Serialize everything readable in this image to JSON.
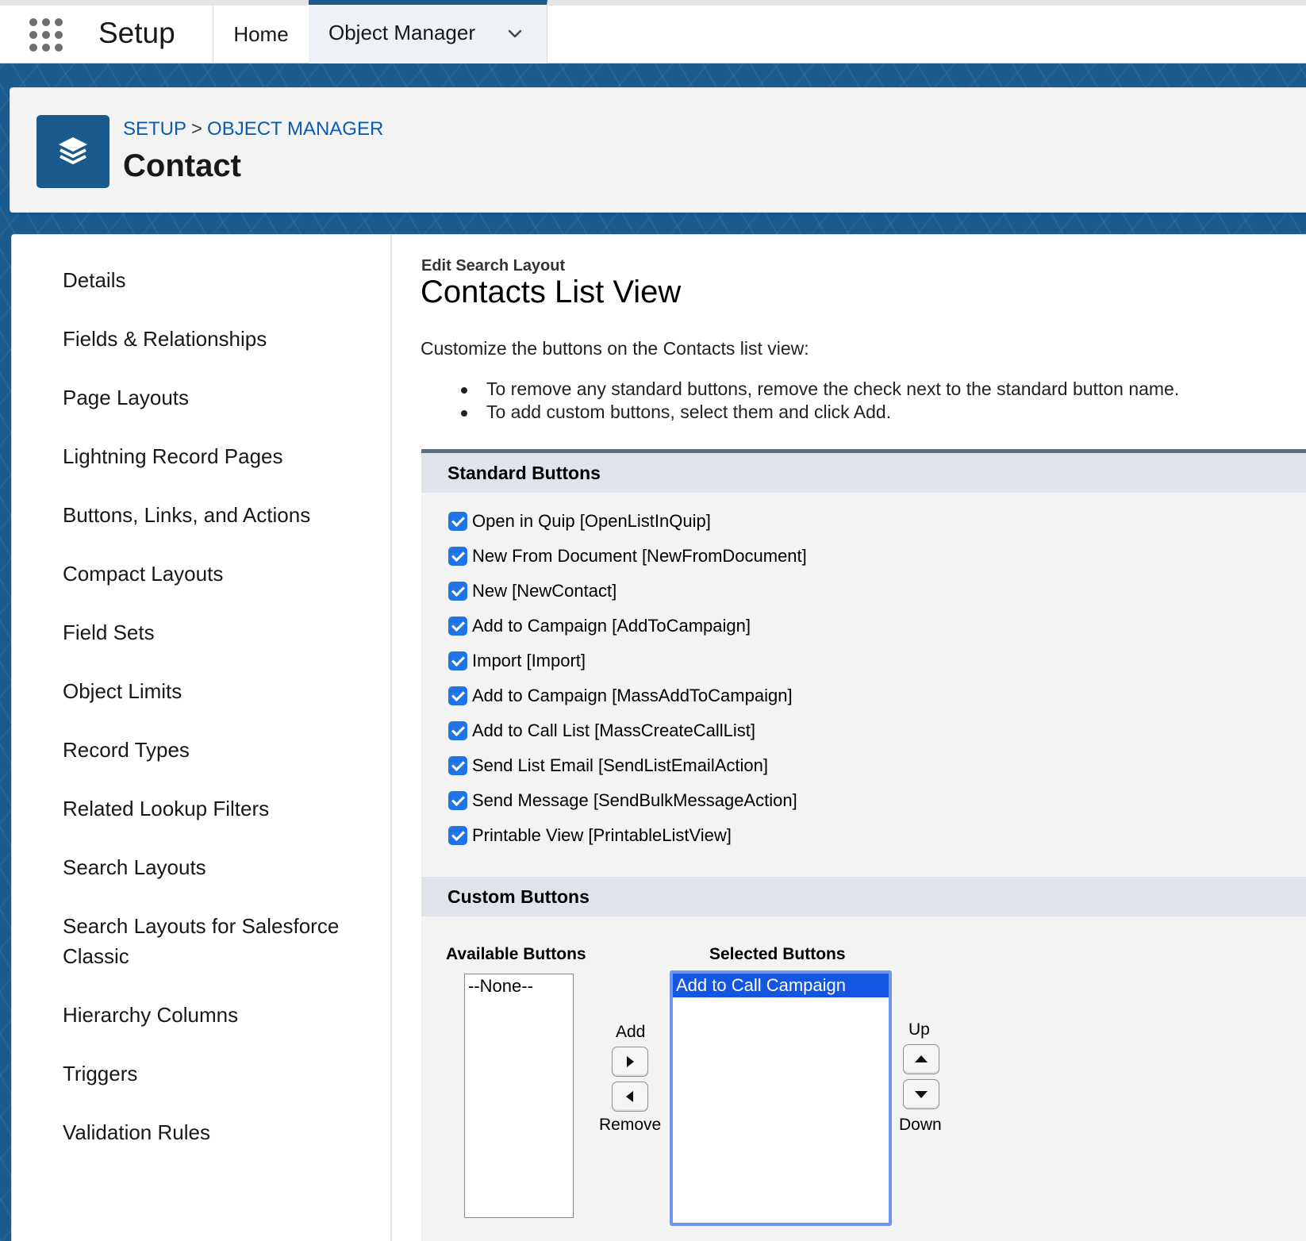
{
  "topnav": {
    "app_name": "Setup",
    "tabs": [
      {
        "label": "Home"
      },
      {
        "label": "Object Manager"
      }
    ]
  },
  "header": {
    "breadcrumb": [
      "SETUP",
      "OBJECT MANAGER"
    ],
    "breadcrumb_separator": ">",
    "title": "Contact",
    "icon": "layers-icon"
  },
  "sidebar": {
    "items": [
      {
        "label": "Details"
      },
      {
        "label": "Fields & Relationships"
      },
      {
        "label": "Page Layouts"
      },
      {
        "label": "Lightning Record Pages"
      },
      {
        "label": "Buttons, Links, and Actions"
      },
      {
        "label": "Compact Layouts"
      },
      {
        "label": "Field Sets"
      },
      {
        "label": "Object Limits"
      },
      {
        "label": "Record Types"
      },
      {
        "label": "Related Lookup Filters"
      },
      {
        "label": "Search Layouts"
      },
      {
        "label": "Search Layouts for Salesforce Classic"
      },
      {
        "label": "Hierarchy Columns"
      },
      {
        "label": "Triggers"
      },
      {
        "label": "Validation Rules"
      }
    ]
  },
  "main": {
    "subtitle": "Edit Search Layout",
    "title": "Contacts List View",
    "instructions": "Customize the buttons on the Contacts list view:",
    "bullets": [
      "To remove any standard buttons, remove the check next to the standard button name.",
      "To add custom buttons, select them and click Add."
    ],
    "standard_buttons": {
      "header": "Standard Buttons",
      "items": [
        {
          "label": "Open in Quip [OpenListInQuip]",
          "checked": true
        },
        {
          "label": "New From Document [NewFromDocument]",
          "checked": true
        },
        {
          "label": "New [NewContact]",
          "checked": true
        },
        {
          "label": "Add to Campaign [AddToCampaign]",
          "checked": true
        },
        {
          "label": "Import [Import]",
          "checked": true
        },
        {
          "label": "Add to Campaign [MassAddToCampaign]",
          "checked": true
        },
        {
          "label": "Add to Call List [MassCreateCallList]",
          "checked": true
        },
        {
          "label": "Send List Email [SendListEmailAction]",
          "checked": true
        },
        {
          "label": "Send Message [SendBulkMessageAction]",
          "checked": true
        },
        {
          "label": "Printable View [PrintableListView]",
          "checked": true
        }
      ]
    },
    "custom_buttons": {
      "header": "Custom Buttons",
      "available_label": "Available Buttons",
      "available_options": [
        "--None--"
      ],
      "selected_label": "Selected Buttons",
      "selected_options": [
        "Add to Call Campaign"
      ],
      "add_label": "Add",
      "remove_label": "Remove",
      "up_label": "Up",
      "down_label": "Down"
    }
  },
  "colors": {
    "brand_blue": "#1b5a8d",
    "link_blue": "#0b5cab",
    "checkbox_blue": "#1e74e8",
    "selection_blue": "#1556e0"
  }
}
